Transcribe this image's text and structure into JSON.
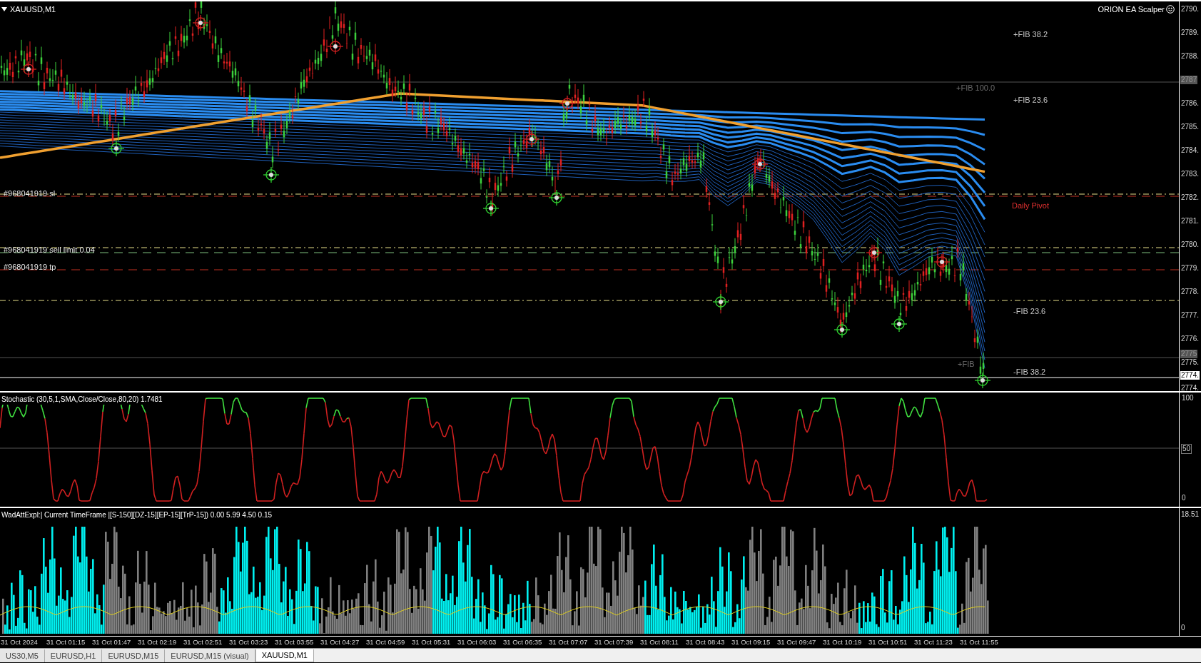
{
  "main_chart": {
    "symbol": "XAUUSD,M1",
    "expert": "ORION EA Scalper",
    "labels": [
      {
        "text": "+FIB 38.2",
        "kind": "fib"
      },
      {
        "text": "+FIB 100.0",
        "kind": "faint"
      },
      {
        "text": "+FIB 23.6",
        "kind": "fib"
      },
      {
        "text": "#968041919 sl",
        "kind": "order"
      },
      {
        "text": "Daily Pivot",
        "kind": "pivot"
      },
      {
        "text": "#968041919 sell limit 0.04",
        "kind": "order"
      },
      {
        "text": "#968041919 tp",
        "kind": "order"
      },
      {
        "text": "-FIB 23.6",
        "kind": "fib"
      },
      {
        "text": "+FIB",
        "kind": "faint"
      },
      {
        "text": "-FIB 38.2",
        "kind": "fib"
      }
    ],
    "price_axis": [
      {
        "text": "2790.",
        "kind": "plain"
      },
      {
        "text": "2789.",
        "kind": "plain"
      },
      {
        "text": "2788.",
        "kind": "plain"
      },
      {
        "text": "2787",
        "kind": "marker"
      },
      {
        "text": "2786.",
        "kind": "plain"
      },
      {
        "text": "2785.",
        "kind": "plain"
      },
      {
        "text": "2784.",
        "kind": "plain"
      },
      {
        "text": "2783.",
        "kind": "plain"
      },
      {
        "text": "2782.",
        "kind": "plain"
      },
      {
        "text": "2781.",
        "kind": "plain"
      },
      {
        "text": "2780.",
        "kind": "plain"
      },
      {
        "text": "2779.",
        "kind": "plain"
      },
      {
        "text": "2778.",
        "kind": "plain"
      },
      {
        "text": "2777.",
        "kind": "plain"
      },
      {
        "text": "2776.",
        "kind": "plain"
      },
      {
        "text": "2775",
        "kind": "marker"
      },
      {
        "text": "2775.",
        "kind": "plain"
      },
      {
        "text": "2774.",
        "kind": "current"
      },
      {
        "text": "2774.",
        "kind": "plain"
      }
    ]
  },
  "stochastic": {
    "title": "Stochastic (30,5,1,SMA,Close/Close,80,20) 1.7481",
    "axis": [
      "100",
      "50",
      "0"
    ]
  },
  "wad": {
    "title": "WadAttExpl:| Current TimeFrame |[S-150][DZ-15][EP-15][TrP-15]) 0.00 5.99 4.50 0.15",
    "axis": [
      "18.51",
      "0"
    ]
  },
  "time_axis": [
    "31 Oct 2024",
    "31 Oct 01:15",
    "31 Oct 01:47",
    "31 Oct 02:19",
    "31 Oct 02:51",
    "31 Oct 03:23",
    "31 Oct 03:55",
    "31 Oct 04:27",
    "31 Oct 04:59",
    "31 Oct 05:31",
    "31 Oct 06:03",
    "31 Oct 06:35",
    "31 Oct 07:07",
    "31 Oct 07:39",
    "31 Oct 08:11",
    "31 Oct 08:43",
    "31 Oct 09:15",
    "31 Oct 09:47",
    "31 Oct 10:19",
    "31 Oct 10:51",
    "31 Oct 11:23",
    "31 Oct 11:55"
  ],
  "tabs": [
    {
      "label": "US30,M5",
      "selected": false
    },
    {
      "label": "EURUSD,H1",
      "selected": false
    },
    {
      "label": "EURUSD,M15",
      "selected": false
    },
    {
      "label": "EURUSD,M15 (visual)",
      "selected": false
    },
    {
      "label": "XAUUSD,M1",
      "selected": true
    }
  ]
}
